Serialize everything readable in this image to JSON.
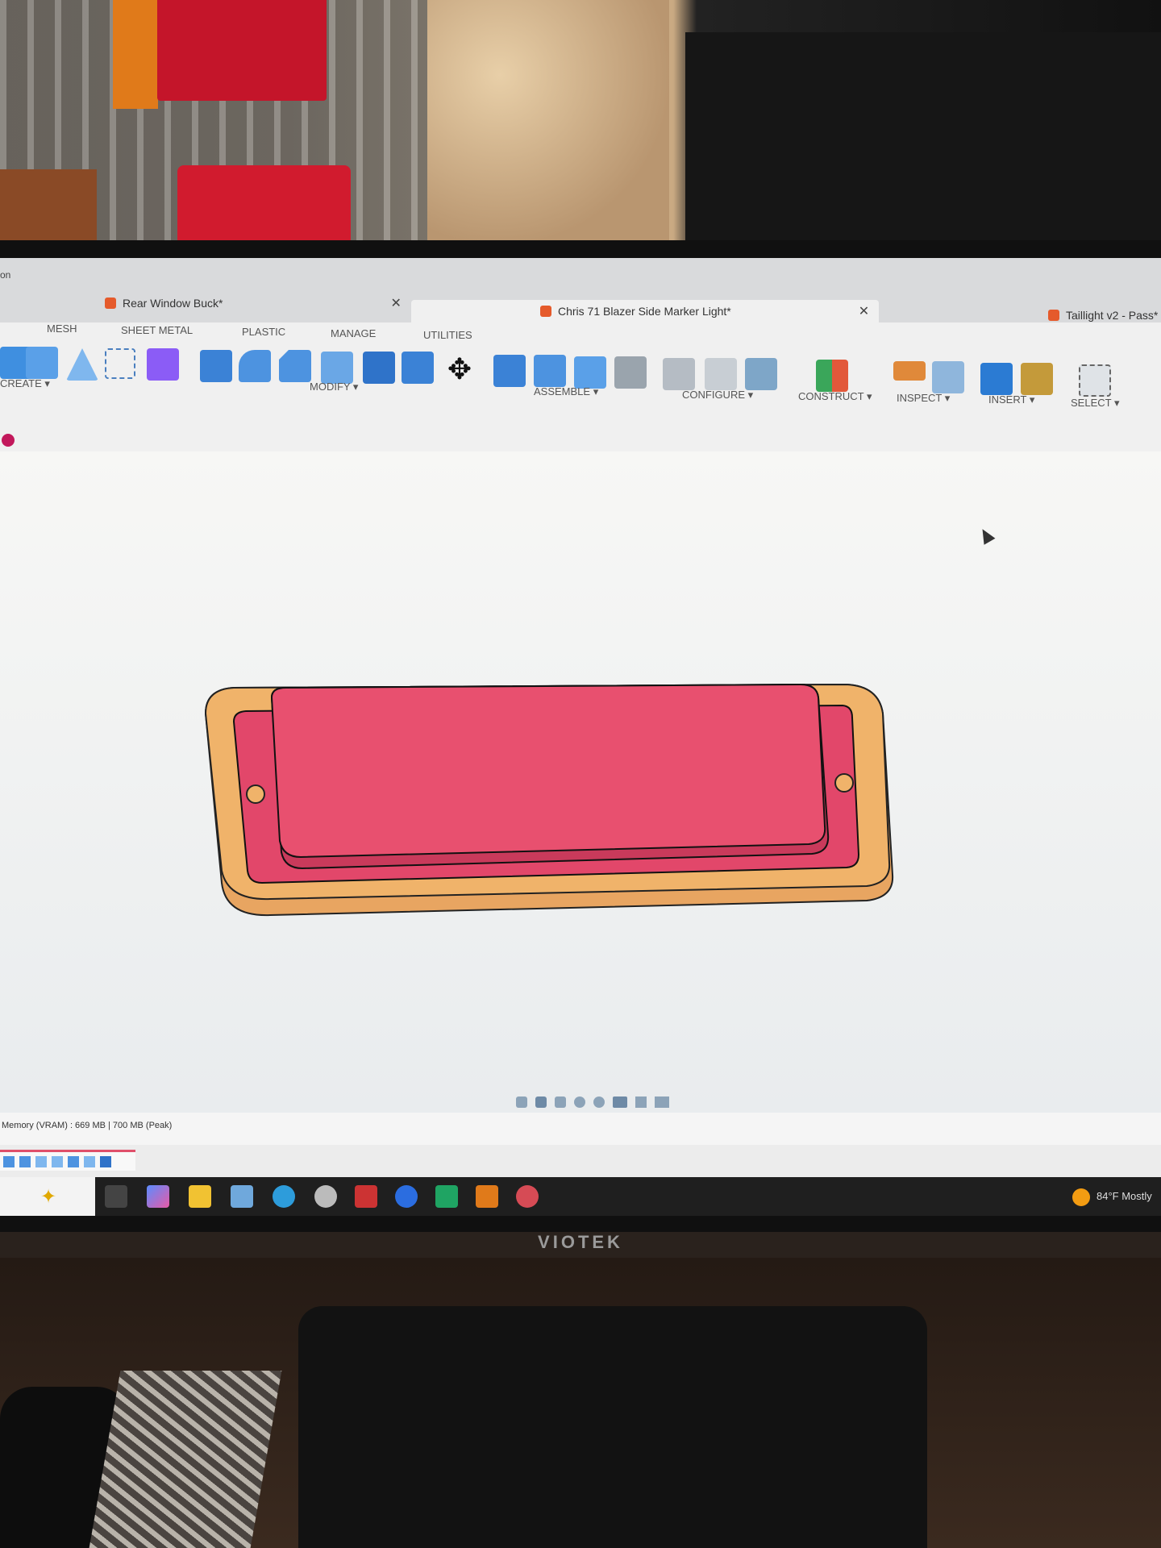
{
  "tabs": [
    {
      "label": "Rear Window Buck*",
      "active": false
    },
    {
      "label": "Chris 71 Blazer Side Marker Light*",
      "active": true
    },
    {
      "label": "Taillight v2 - Pass*",
      "active": false
    }
  ],
  "ribbon": {
    "partial_left": "on",
    "tabs": [
      "MESH",
      "SHEET METAL",
      "PLASTIC",
      "MANAGE",
      "UTILITIES"
    ],
    "groups": [
      "CREATE ▾",
      "MODIFY ▾",
      "ASSEMBLE ▾",
      "CONFIGURE ▾",
      "CONSTRUCT ▾",
      "INSPECT ▾",
      "INSERT ▾",
      "SELECT ▾"
    ]
  },
  "status": {
    "memory": "Memory (VRAM) : 669 MB | 700 MB (Peak)"
  },
  "taskbar": {
    "weather": "84°F  Mostly"
  },
  "monitor": {
    "brand": "VIOTEK"
  },
  "colors": {
    "part_base": "#f0b36a",
    "part_lens": "#e8506f",
    "canvas_bg": "#f3f3f1"
  }
}
